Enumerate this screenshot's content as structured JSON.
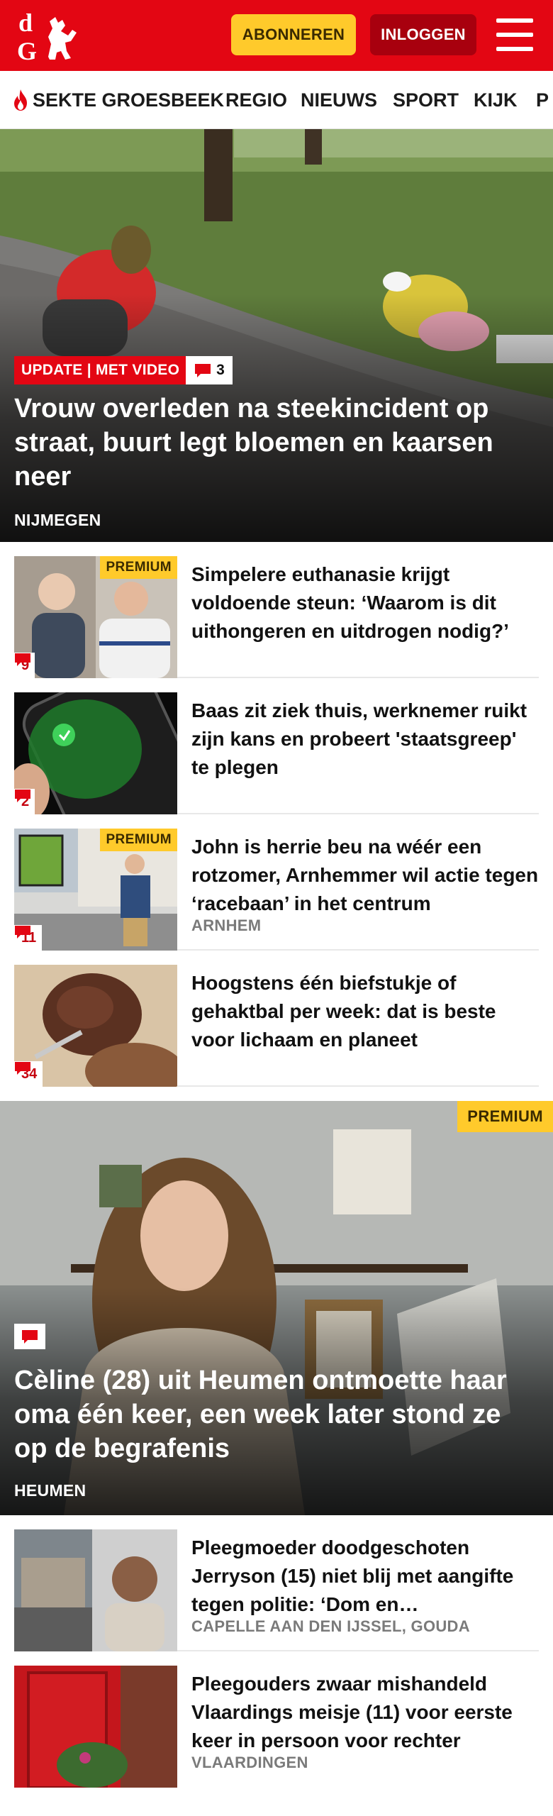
{
  "header": {
    "subscribe_label": "ABONNEREN",
    "login_label": "INLOGGEN",
    "brand_color": "#e30613",
    "accent_color": "#ffca2b"
  },
  "nav": {
    "items": [
      "SEKTE GROESBEEK",
      "REGIO",
      "NIEUWS",
      "SPORT",
      "KIJK",
      "P"
    ]
  },
  "hero": {
    "label": "UPDATE | MET VIDEO",
    "comments": "3",
    "title": "Vrouw overleden na steekincident op straat, buurt legt bloemen en kaarsen neer",
    "location": "NIJMEGEN"
  },
  "articles": [
    {
      "title": "Simpelere euthanasie krijgt voldoende steun: ‘Waarom is dit uithongeren en uitdrogen nodig?’",
      "comments": "9",
      "premium": "PREMIUM",
      "location": ""
    },
    {
      "title": "Baas zit ziek thuis, werknemer ruikt zijn kans en probeert 'staatsgreep' te plegen",
      "comments": "2",
      "premium": "",
      "location": ""
    },
    {
      "title": "John is herrie beu na wéér een rotzomer, Arnhemmer wil actie tegen ‘racebaan’ in het centrum",
      "comments": "11",
      "premium": "PREMIUM",
      "location": "ARNHEM"
    },
    {
      "title": "Hoogstens één biefstukje of gehaktbal per week: dat is beste voor lichaam en planeet",
      "comments": "34",
      "premium": "",
      "location": ""
    }
  ],
  "feature": {
    "premium": "PREMIUM",
    "title": "Cèline (28) uit Heumen ontmoette haar oma één keer, een week later stond ze op de begrafenis",
    "location": "HEUMEN"
  },
  "articles2": [
    {
      "title": "Pleegmoeder doodgeschoten Jerryson (15) niet blij met aangifte tegen politie: ‘Dom en…",
      "location": "CAPELLE AAN DEN IJSSEL, GOUDA"
    },
    {
      "title": "Pleegouders zwaar mishandeld Vlaardings meisje (11) voor eerste keer in persoon voor rechter",
      "location": "VLAARDINGEN"
    }
  ]
}
